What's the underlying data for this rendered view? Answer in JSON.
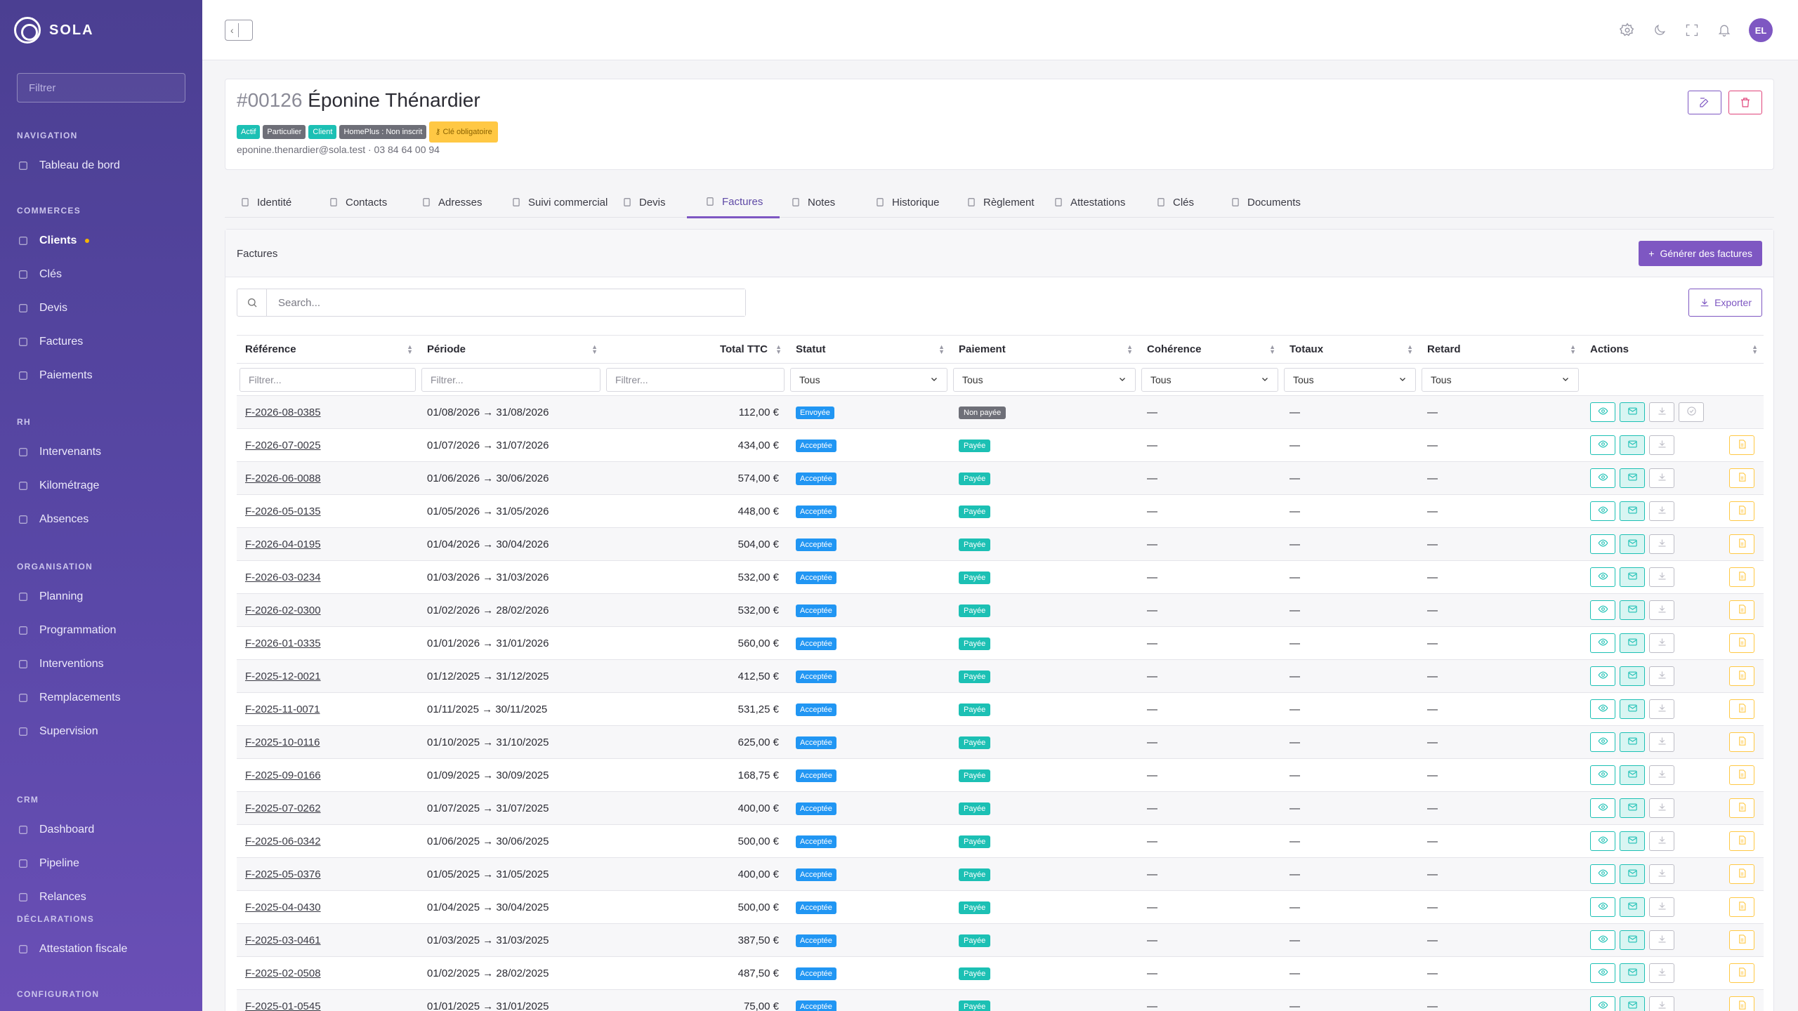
{
  "brand": {
    "name": "SOLA"
  },
  "sidebar": {
    "filter_placeholder": "Filtrer",
    "sections": [
      {
        "title": "NAVIGATION",
        "items": [
          {
            "label": "Tableau de bord",
            "icon": "dashboard-icon"
          }
        ]
      },
      {
        "title": "COMMERCES",
        "items": [
          {
            "label": "Clients",
            "icon": "users-icon",
            "active": true
          },
          {
            "label": "Clés",
            "icon": "key-icon"
          },
          {
            "label": "Devis",
            "icon": "document-icon"
          },
          {
            "label": "Factures",
            "icon": "invoice-icon"
          },
          {
            "label": "Paiements",
            "icon": "dollar-icon"
          }
        ]
      },
      {
        "title": "RH",
        "items": [
          {
            "label": "Intervenants",
            "icon": "people-icon"
          },
          {
            "label": "Kilométrage",
            "icon": "navigation-icon"
          },
          {
            "label": "Absences",
            "icon": "sun-icon"
          }
        ]
      },
      {
        "title": "ORGANISATION",
        "items": [
          {
            "label": "Planning",
            "icon": "calendar-icon"
          },
          {
            "label": "Programmation",
            "icon": "repeat-icon"
          },
          {
            "label": "Interventions",
            "icon": "clock-icon"
          },
          {
            "label": "Remplacements",
            "icon": "shuffle-icon"
          },
          {
            "label": "Supervision",
            "icon": "map-icon"
          }
        ]
      },
      {
        "title": "CRM",
        "items": [
          {
            "label": "Dashboard",
            "icon": "chart-icon"
          },
          {
            "label": "Pipeline",
            "icon": "target-icon"
          },
          {
            "label": "Relances",
            "icon": "bell-icon"
          }
        ]
      },
      {
        "title": "DÉCLARATIONS",
        "items": [
          {
            "label": "Attestation fiscale",
            "icon": "award-icon"
          }
        ]
      },
      {
        "title": "CONFIGURATION",
        "items": []
      }
    ]
  },
  "topbar": {
    "avatar": "EL",
    "icons": [
      "settings-icon",
      "moon-icon",
      "fullscreen-icon",
      "bell-icon"
    ]
  },
  "client": {
    "number": "#00126",
    "name": "Éponine Thénardier",
    "badges": [
      {
        "label": "Actif",
        "kind": "teal"
      },
      {
        "label": "Particulier",
        "kind": "grey"
      },
      {
        "label": "Client",
        "kind": "teal"
      },
      {
        "label": "HomePlus : Non inscrit",
        "kind": "grey"
      },
      {
        "label": "Clé obligatoire",
        "kind": "warn"
      }
    ],
    "meta": "eponine.thenardier@sola.test · 03 84 64 00 94"
  },
  "tabs": [
    {
      "label": "Identité",
      "icon": "user-icon"
    },
    {
      "label": "Contacts",
      "icon": "users-icon"
    },
    {
      "label": "Adresses",
      "icon": "map-pin-icon"
    },
    {
      "label": "Suivi commercial",
      "icon": "building-icon"
    },
    {
      "label": "Devis",
      "icon": "document-icon"
    },
    {
      "label": "Factures",
      "icon": "invoice-icon",
      "active": true
    },
    {
      "label": "Notes",
      "icon": "edit-icon"
    },
    {
      "label": "Historique",
      "icon": "clock-icon"
    },
    {
      "label": "Règlement",
      "icon": "credit-card-icon"
    },
    {
      "label": "Attestations",
      "icon": "award-icon"
    },
    {
      "label": "Clés",
      "icon": "key-icon"
    },
    {
      "label": "Documents",
      "icon": "file-icon"
    }
  ],
  "panel": {
    "title": "Factures",
    "generate_label": "Générer des factures",
    "search_placeholder": "Search...",
    "export_label": "Exporter"
  },
  "table": {
    "columns": [
      "Référence",
      "Période",
      "Total TTC",
      "Statut",
      "Paiement",
      "Cohérence",
      "Totaux",
      "Retard",
      "Actions"
    ],
    "filter_placeholder": "Filtrer...",
    "select_value": "Tous",
    "rows": [
      {
        "ref": "F-2026-08-0385",
        "period": "01/08/2026 → 31/08/2026",
        "total": "112,00 €",
        "status": "Envoyée",
        "payment": "Non payée",
        "coherence": "—",
        "totaux": "—",
        "retard": "—"
      },
      {
        "ref": "F-2026-07-0025",
        "period": "01/07/2026 → 31/07/2026",
        "total": "434,00 €",
        "status": "Acceptée",
        "payment": "Payée",
        "coherence": "—",
        "totaux": "—",
        "retard": "—"
      },
      {
        "ref": "F-2026-06-0088",
        "period": "01/06/2026 → 30/06/2026",
        "total": "574,00 €",
        "status": "Acceptée",
        "payment": "Payée",
        "coherence": "—",
        "totaux": "—",
        "retard": "—"
      },
      {
        "ref": "F-2026-05-0135",
        "period": "01/05/2026 → 31/05/2026",
        "total": "448,00 €",
        "status": "Acceptée",
        "payment": "Payée",
        "coherence": "—",
        "totaux": "—",
        "retard": "—"
      },
      {
        "ref": "F-2026-04-0195",
        "period": "01/04/2026 → 30/04/2026",
        "total": "504,00 €",
        "status": "Acceptée",
        "payment": "Payée",
        "coherence": "—",
        "totaux": "—",
        "retard": "—"
      },
      {
        "ref": "F-2026-03-0234",
        "period": "01/03/2026 → 31/03/2026",
        "total": "532,00 €",
        "status": "Acceptée",
        "payment": "Payée",
        "coherence": "—",
        "totaux": "—",
        "retard": "—"
      },
      {
        "ref": "F-2026-02-0300",
        "period": "01/02/2026 → 28/02/2026",
        "total": "532,00 €",
        "status": "Acceptée",
        "payment": "Payée",
        "coherence": "—",
        "totaux": "—",
        "retard": "—"
      },
      {
        "ref": "F-2026-01-0335",
        "period": "01/01/2026 → 31/01/2026",
        "total": "560,00 €",
        "status": "Acceptée",
        "payment": "Payée",
        "coherence": "—",
        "totaux": "—",
        "retard": "—"
      },
      {
        "ref": "F-2025-12-0021",
        "period": "01/12/2025 → 31/12/2025",
        "total": "412,50 €",
        "status": "Acceptée",
        "payment": "Payée",
        "coherence": "—",
        "totaux": "—",
        "retard": "—"
      },
      {
        "ref": "F-2025-11-0071",
        "period": "01/11/2025 → 30/11/2025",
        "total": "531,25 €",
        "status": "Acceptée",
        "payment": "Payée",
        "coherence": "—",
        "totaux": "—",
        "retard": "—"
      },
      {
        "ref": "F-2025-10-0116",
        "period": "01/10/2025 → 31/10/2025",
        "total": "625,00 €",
        "status": "Acceptée",
        "payment": "Payée",
        "coherence": "—",
        "totaux": "—",
        "retard": "—"
      },
      {
        "ref": "F-2025-09-0166",
        "period": "01/09/2025 → 30/09/2025",
        "total": "168,75 €",
        "status": "Acceptée",
        "payment": "Payée",
        "coherence": "—",
        "totaux": "—",
        "retard": "—"
      },
      {
        "ref": "F-2025-07-0262",
        "period": "01/07/2025 → 31/07/2025",
        "total": "400,00 €",
        "status": "Acceptée",
        "payment": "Payée",
        "coherence": "—",
        "totaux": "—",
        "retard": "—"
      },
      {
        "ref": "F-2025-06-0342",
        "period": "01/06/2025 → 30/06/2025",
        "total": "500,00 €",
        "status": "Acceptée",
        "payment": "Payée",
        "coherence": "—",
        "totaux": "—",
        "retard": "—"
      },
      {
        "ref": "F-2025-05-0376",
        "period": "01/05/2025 → 31/05/2025",
        "total": "400,00 €",
        "status": "Acceptée",
        "payment": "Payée",
        "coherence": "—",
        "totaux": "—",
        "retard": "—"
      },
      {
        "ref": "F-2025-04-0430",
        "period": "01/04/2025 → 30/04/2025",
        "total": "500,00 €",
        "status": "Acceptée",
        "payment": "Payée",
        "coherence": "—",
        "totaux": "—",
        "retard": "—"
      },
      {
        "ref": "F-2025-03-0461",
        "period": "01/03/2025 → 31/03/2025",
        "total": "387,50 €",
        "status": "Acceptée",
        "payment": "Payée",
        "coherence": "—",
        "totaux": "—",
        "retard": "—"
      },
      {
        "ref": "F-2025-02-0508",
        "period": "01/02/2025 → 28/02/2025",
        "total": "487,50 €",
        "status": "Acceptée",
        "payment": "Payée",
        "coherence": "—",
        "totaux": "—",
        "retard": "—"
      },
      {
        "ref": "F-2025-01-0545",
        "period": "01/01/2025 → 31/01/2025",
        "total": "75,00 €",
        "status": "Acceptée",
        "payment": "Payée",
        "coherence": "—",
        "totaux": "—",
        "retard": "—"
      }
    ]
  }
}
